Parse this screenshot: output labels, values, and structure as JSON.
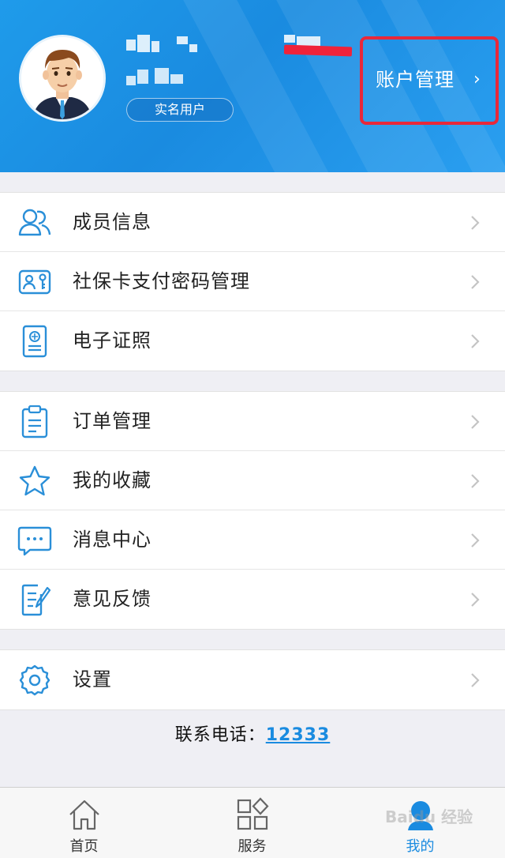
{
  "header": {
    "badge": "实名用户",
    "account_label": "账户管理",
    "account_chevron": "›"
  },
  "groups": [
    {
      "items": [
        {
          "label": "成员信息",
          "icon": "members-icon"
        },
        {
          "label": "社保卡支付密码管理",
          "icon": "card-key-icon"
        },
        {
          "label": "电子证照",
          "icon": "certificate-icon"
        }
      ]
    },
    {
      "items": [
        {
          "label": "订单管理",
          "icon": "clipboard-icon"
        },
        {
          "label": "我的收藏",
          "icon": "star-icon"
        },
        {
          "label": "消息中心",
          "icon": "message-icon"
        },
        {
          "label": "意见反馈",
          "icon": "feedback-icon"
        }
      ]
    },
    {
      "items": [
        {
          "label": "设置",
          "icon": "gear-icon"
        }
      ]
    }
  ],
  "contact": {
    "label": "联系电话：",
    "number": "12333"
  },
  "tabs": [
    {
      "label": "首页",
      "icon": "home-icon"
    },
    {
      "label": "服务",
      "icon": "grid-icon"
    },
    {
      "label": "我的",
      "icon": "profile-icon",
      "active": true
    }
  ],
  "watermark": "Baidu 经验",
  "colors": {
    "accent": "#1a8be0",
    "highlight": "#e8283a",
    "icon": "#2a8fd8"
  }
}
